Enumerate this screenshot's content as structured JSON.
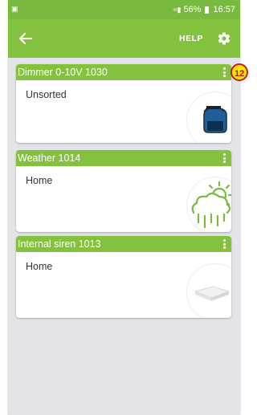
{
  "status_bar": {
    "left_icon": "image-icon",
    "battery_percent": "56%",
    "time": "16:57"
  },
  "app_bar": {
    "help_label": "HELP"
  },
  "devices": [
    {
      "name": "Dimmer 0-10V 1030",
      "room": "Unsorted",
      "icon": "dimmer-module-icon"
    },
    {
      "name": "Weather 1014",
      "room": "Home",
      "icon": "weather-cloud-sun-rain-icon"
    },
    {
      "name": "Internal siren 1013",
      "room": "Home",
      "icon": "siren-device-icon"
    }
  ],
  "badge": {
    "text": "12"
  },
  "colors": {
    "accent": "#84c13f",
    "status_bar": "#7ab93f",
    "background": "#e2e4e8"
  }
}
